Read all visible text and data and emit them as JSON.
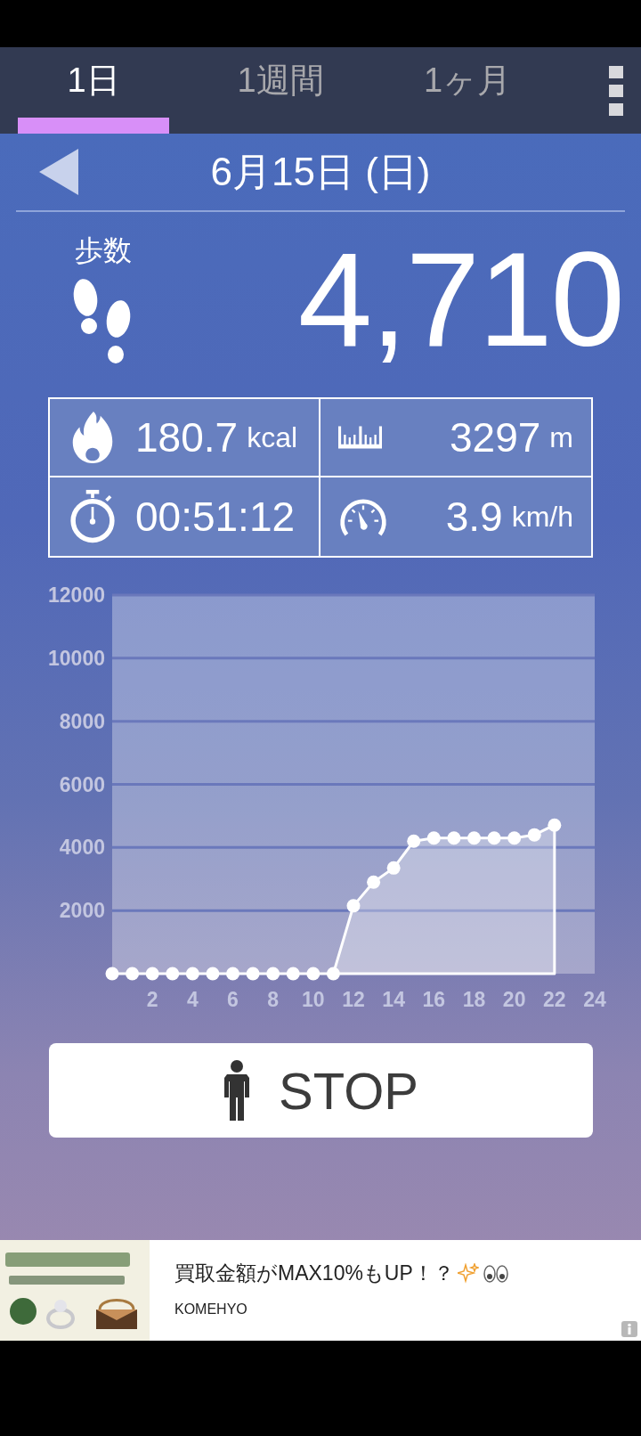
{
  "tabs": [
    {
      "label": "1日",
      "selected": true
    },
    {
      "label": "1週間",
      "selected": false
    },
    {
      "label": "1ヶ月",
      "selected": false
    }
  ],
  "date": {
    "label": "6月15日 (日)"
  },
  "steps": {
    "label": "歩数",
    "value": "4,710"
  },
  "stats": [
    {
      "kind": "calories",
      "value": "180.7",
      "unit": "kcal"
    },
    {
      "kind": "distance",
      "value": "3297",
      "unit": "m"
    },
    {
      "kind": "time",
      "value": "00:51:12"
    },
    {
      "kind": "speed",
      "value": "3.9",
      "unit": "km/h"
    }
  ],
  "chart": {
    "chart_data": {
      "type": "area",
      "grid": true,
      "x": [
        0,
        1,
        2,
        3,
        4,
        5,
        6,
        7,
        8,
        9,
        10,
        11,
        12,
        13,
        14,
        15,
        16,
        17,
        18,
        19,
        20,
        21,
        22
      ],
      "series": [
        {
          "color": "#ffffff",
          "marker": "circle",
          "values": [
            0,
            0,
            0,
            0,
            0,
            0,
            0,
            0,
            0,
            0,
            0,
            0,
            2150,
            2900,
            3350,
            4200,
            4300,
            4300,
            4300,
            4300,
            4300,
            4400,
            4710
          ]
        }
      ],
      "xlim": [
        0,
        24
      ],
      "ylim": [
        0,
        12000
      ],
      "xticks": [
        2,
        4,
        6,
        8,
        10,
        12,
        14,
        16,
        18,
        20,
        22,
        24
      ],
      "yticks": [
        2000,
        4000,
        6000,
        8000,
        10000,
        12000
      ]
    }
  },
  "action_button": {
    "label": "STOP"
  },
  "ad": {
    "headline": "買取金額がMAX10%もUP！？",
    "advertiser": "KOMEHYO"
  }
}
